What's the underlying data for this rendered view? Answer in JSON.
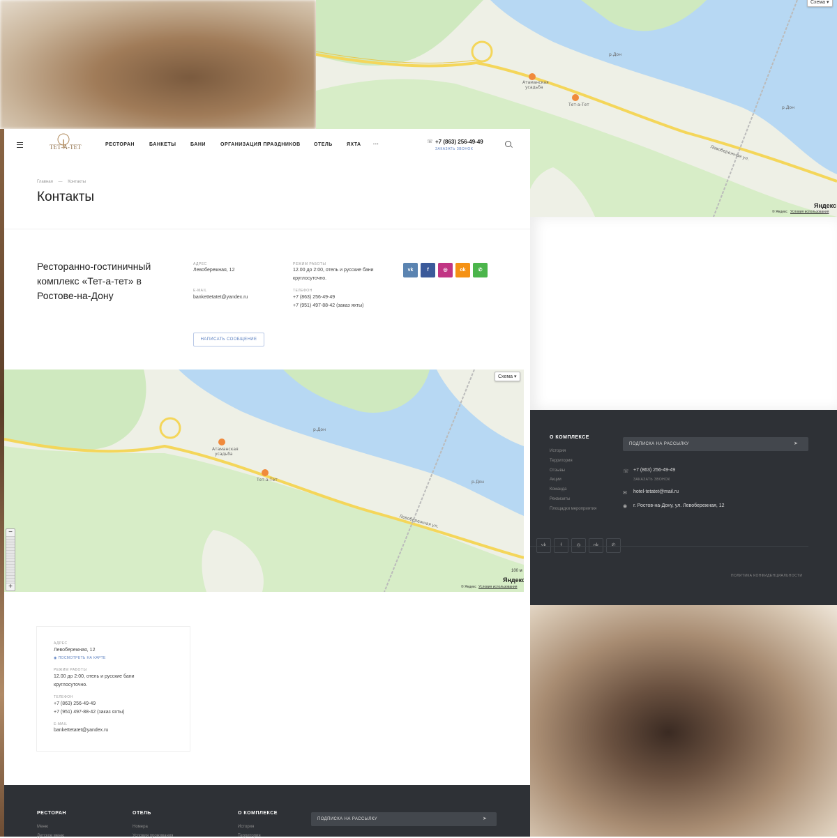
{
  "header": {
    "logo_text": "ТЕТ-А-ТЕТ",
    "nav": [
      "РЕСТОРАН",
      "БАНКЕТЫ",
      "БАНИ",
      "ОРГАНИЗАЦИЯ ПРАЗДНИКОВ",
      "ОТЕЛЬ",
      "ЯХТА"
    ],
    "more": "···",
    "phone": "+7 (863) 256-49-49",
    "callback": "ЗАКАЗАТЬ ЗВОНОК"
  },
  "breadcrumb": {
    "home": "Главная",
    "sep": "—",
    "current": "Контакты"
  },
  "page_title": "Контакты",
  "company": {
    "name": "Ресторанно-гостиничный комплекс «Тет-а-тет» в Ростове-на-Дону",
    "address_label": "АДРЕС",
    "address": "Левобережная, 12",
    "email_label": "E-MAIL",
    "email": "bankettetatet@yandex.ru",
    "hours_label": "РЕЖИМ РАБОТЫ",
    "hours_line1": "12.00 до 2:00, отель и русские бани",
    "hours_line2": "круглосуточно.",
    "phone_label": "ТЕЛЕФОН",
    "phone1": "+7 (863) 256-49-49",
    "phone2": "+7 (951) 497-88-42 (заказ яхты)",
    "write_button": "НАПИСАТЬ СООБЩЕНИЕ"
  },
  "social": {
    "vk": "vk",
    "fb": "f",
    "ig": "◎",
    "ok": "ok",
    "wa": "✆",
    "colors": {
      "vk": "#5b84b1",
      "fb": "#3b5a9a",
      "ig": "#c13584",
      "ok": "#f59114",
      "wa": "#4bb54b"
    }
  },
  "map": {
    "scheme_btn": "Схема ▾",
    "top_scheme_btn": "Схема ▾",
    "river1": "р.Дон",
    "river2": "р.Дон",
    "street": "Левобережная ул.",
    "poi1_line1": "Атаманская",
    "poi1_line2": "усадьба",
    "poi2": "Тет-а-Тет",
    "scale": "100 м",
    "yandex": "Яндекс",
    "copyright": "© Яндекс",
    "terms": "Условия использования",
    "zoom_plus": "+",
    "zoom_minus": "−"
  },
  "infobox": {
    "address_label": "АДРЕС",
    "address": "Левобережная, 12",
    "map_link": "ПОСМОТРЕТЬ НА КАРТЕ",
    "hours_label": "РЕЖИМ РАБОТЫ",
    "hours_line1": "12.00 до 2:00, отель и русские бани",
    "hours_line2": "круглосуточно.",
    "phone_label": "ТЕЛЕФОН",
    "phone1": "+7 (863) 256-49-49",
    "phone2": "+7 (951) 497-88-42 (заказ яхты)",
    "email_label": "E-MAIL",
    "email": "bankettetatet@yandex.ru"
  },
  "footer_right": {
    "heading": "О КОМПЛЕКСЕ",
    "links": [
      "История",
      "Территория",
      "Отзывы",
      "Акции",
      "Команда",
      "Реквизиты",
      "Площадки мероприятия"
    ],
    "subscribe": "ПОДПИСКА НА РАССЫЛКУ",
    "phone": "+7 (863) 256-49-49",
    "callback": "ЗАКАЗАТЬ ЗВОНОК",
    "email": "hotel-tetatet@mail.ru",
    "address": "г. Ростов-на-Дону, ул. Левобережная, 12",
    "privacy": "ПОЛИТИКА КОНФИДЕНЦИАЛЬНОСТИ"
  },
  "footer_bottom": {
    "col1_heading": "РЕСТОРАН",
    "col1_link1": "Меню",
    "col1_link2": "Детское меню",
    "col2_heading": "ОТЕЛЬ",
    "col2_link1": "Номера",
    "col2_link2": "Условия проживания",
    "col3_heading": "О КОМПЛЕКСЕ",
    "col3_link1": "История",
    "col3_link2": "Территория",
    "subscribe": "ПОДПИСКА НА РАССЫЛКУ"
  }
}
